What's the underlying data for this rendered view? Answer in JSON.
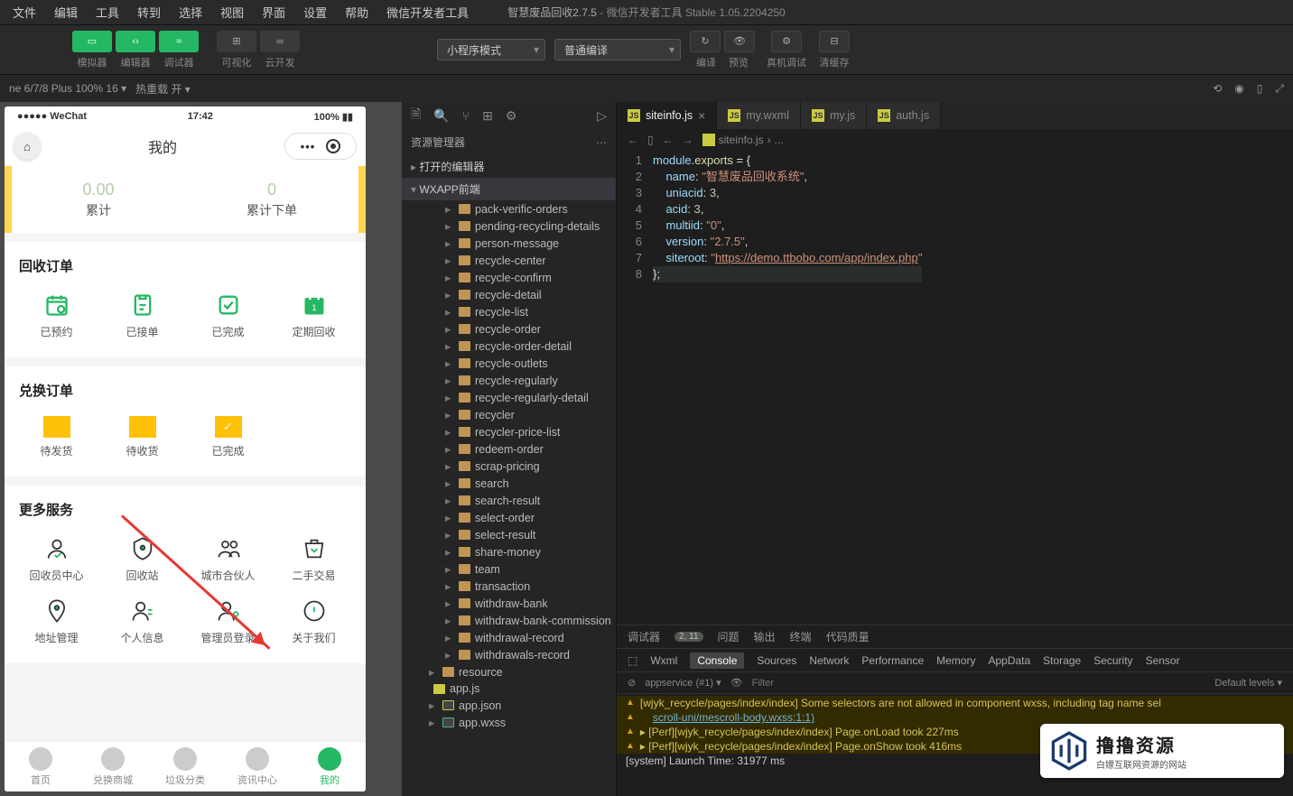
{
  "title": {
    "app": "智慧废品回收2.7.5",
    "suffix": " - 微信开发者工具 Stable 1.05.2204250"
  },
  "menu": [
    "文件",
    "编辑",
    "工具",
    "转到",
    "选择",
    "视图",
    "界面",
    "设置",
    "帮助",
    "微信开发者工具"
  ],
  "toolbar": {
    "sim": "模拟器",
    "edit": "编辑器",
    "dbg": "调试器",
    "vis": "可视化",
    "cloud": "云开发",
    "mode": "小程序模式",
    "compile": "普通编译",
    "compile_lbl": "编译",
    "preview": "预览",
    "remote": "真机调试",
    "cache": "清缓存"
  },
  "simstatus": {
    "device": "ne 6/7/8 Plus 100% 16 ▾",
    "hot": "热重载 开 ▾"
  },
  "phone": {
    "status": {
      "l": "●●●●● WeChat",
      "c": "17:42",
      "r": "100%"
    },
    "nav": "我的",
    "hero": [
      {
        "n": "0.00",
        "l": "累计"
      },
      {
        "n": "0",
        "l": "累计下单"
      }
    ],
    "sec1": {
      "title": "回收订单",
      "items": [
        "已预约",
        "已接单",
        "已完成",
        "定期回收"
      ]
    },
    "sec2": {
      "title": "兑换订单",
      "items": [
        "待发货",
        "待收货",
        "已完成"
      ]
    },
    "sec3": {
      "title": "更多服务",
      "items": [
        "回收员中心",
        "回收站",
        "城市合伙人",
        "二手交易",
        "地址管理",
        "个人信息",
        "管理员登录",
        "关于我们"
      ]
    },
    "tabs": [
      "首页",
      "兑换商城",
      "垃圾分类",
      "资讯中心",
      "我的"
    ]
  },
  "explorer": {
    "title": "资源管理器",
    "sec1": "打开的编辑器",
    "sec2": "WXAPP前端",
    "folders": [
      "pack-verific-orders",
      "pending-recycling-details",
      "person-message",
      "recycle-center",
      "recycle-confirm",
      "recycle-detail",
      "recycle-list",
      "recycle-order",
      "recycle-order-detail",
      "recycle-outlets",
      "recycle-regularly",
      "recycle-regularly-detail",
      "recycler",
      "recycler-price-list",
      "redeem-order",
      "scrap-pricing",
      "search",
      "search-result",
      "select-order",
      "select-result",
      "share-money",
      "team",
      "transaction",
      "withdraw-bank",
      "withdraw-bank-commission",
      "withdrawal-record",
      "withdrawals-record"
    ],
    "resource": "resource",
    "files": [
      {
        "n": "app.js",
        "t": "js"
      },
      {
        "n": "app.json",
        "t": "json"
      },
      {
        "n": "app.wxss",
        "t": "wxss"
      }
    ]
  },
  "tabs": [
    {
      "n": "siteinfo.js",
      "a": true
    },
    {
      "n": "my.wxml"
    },
    {
      "n": "my.js"
    },
    {
      "n": "auth.js"
    }
  ],
  "crumb": {
    "file": "siteinfo.js",
    "sep": "›",
    "more": "..."
  },
  "code": {
    "l1a": "module",
    "l1b": ".",
    "l1c": "exports",
    "l1d": " = {",
    "l2a": "name",
    "l2b": ": ",
    "l2c": "\"智慧废品回收系统\"",
    "l2d": ",",
    "l3a": "uniacid",
    "l3b": ": ",
    "l3c": "3",
    "l3d": ",",
    "l4a": "acid",
    "l4b": ": ",
    "l4c": "3",
    "l4d": ",",
    "l5a": "multiid",
    "l5b": ": ",
    "l5c": "\"0\"",
    "l5d": ",",
    "l6a": "version",
    "l6b": ": ",
    "l6c": "\"2.7.5\"",
    "l6d": ",",
    "l7a": "siteroot",
    "l7b": ": ",
    "l7c": "\"",
    "l7d": "https://demo.ttbobo.com/app/index.php",
    "l7e": "\"",
    "l8": "};"
  },
  "dbg": {
    "top": [
      "调试器",
      "2, 11",
      "问题",
      "输出",
      "终端",
      "代码质量"
    ],
    "panels": [
      "Wxml",
      "Console",
      "Sources",
      "Network",
      "Performance",
      "Memory",
      "AppData",
      "Storage",
      "Security",
      "Sensor"
    ],
    "filter": {
      "ctx": "appservice (#1)",
      "ph": "Filter",
      "lvl": "Default levels ▾"
    },
    "lines": [
      {
        "t": "warn",
        "txt": "[wjyk_recycle/pages/index/index] Some selectors are not allowed in component wxss, including tag name sel"
      },
      {
        "t": "warn",
        "txt": "scroll-uni/mescroll-body.wxss:1:1)",
        "link": true,
        "indent": true
      },
      {
        "t": "warn",
        "txt": "▸ [Perf][wjyk_recycle/pages/index/index] Page.onLoad took 227ms"
      },
      {
        "t": "warn",
        "txt": "▸ [Perf][wjyk_recycle/pages/index/index] Page.onShow took 416ms"
      },
      {
        "t": "info",
        "txt": "[system] Launch Time: 31977 ms"
      }
    ]
  },
  "watermark": {
    "t": "撸撸资源",
    "s": "白嫖互联网资源的网站"
  }
}
